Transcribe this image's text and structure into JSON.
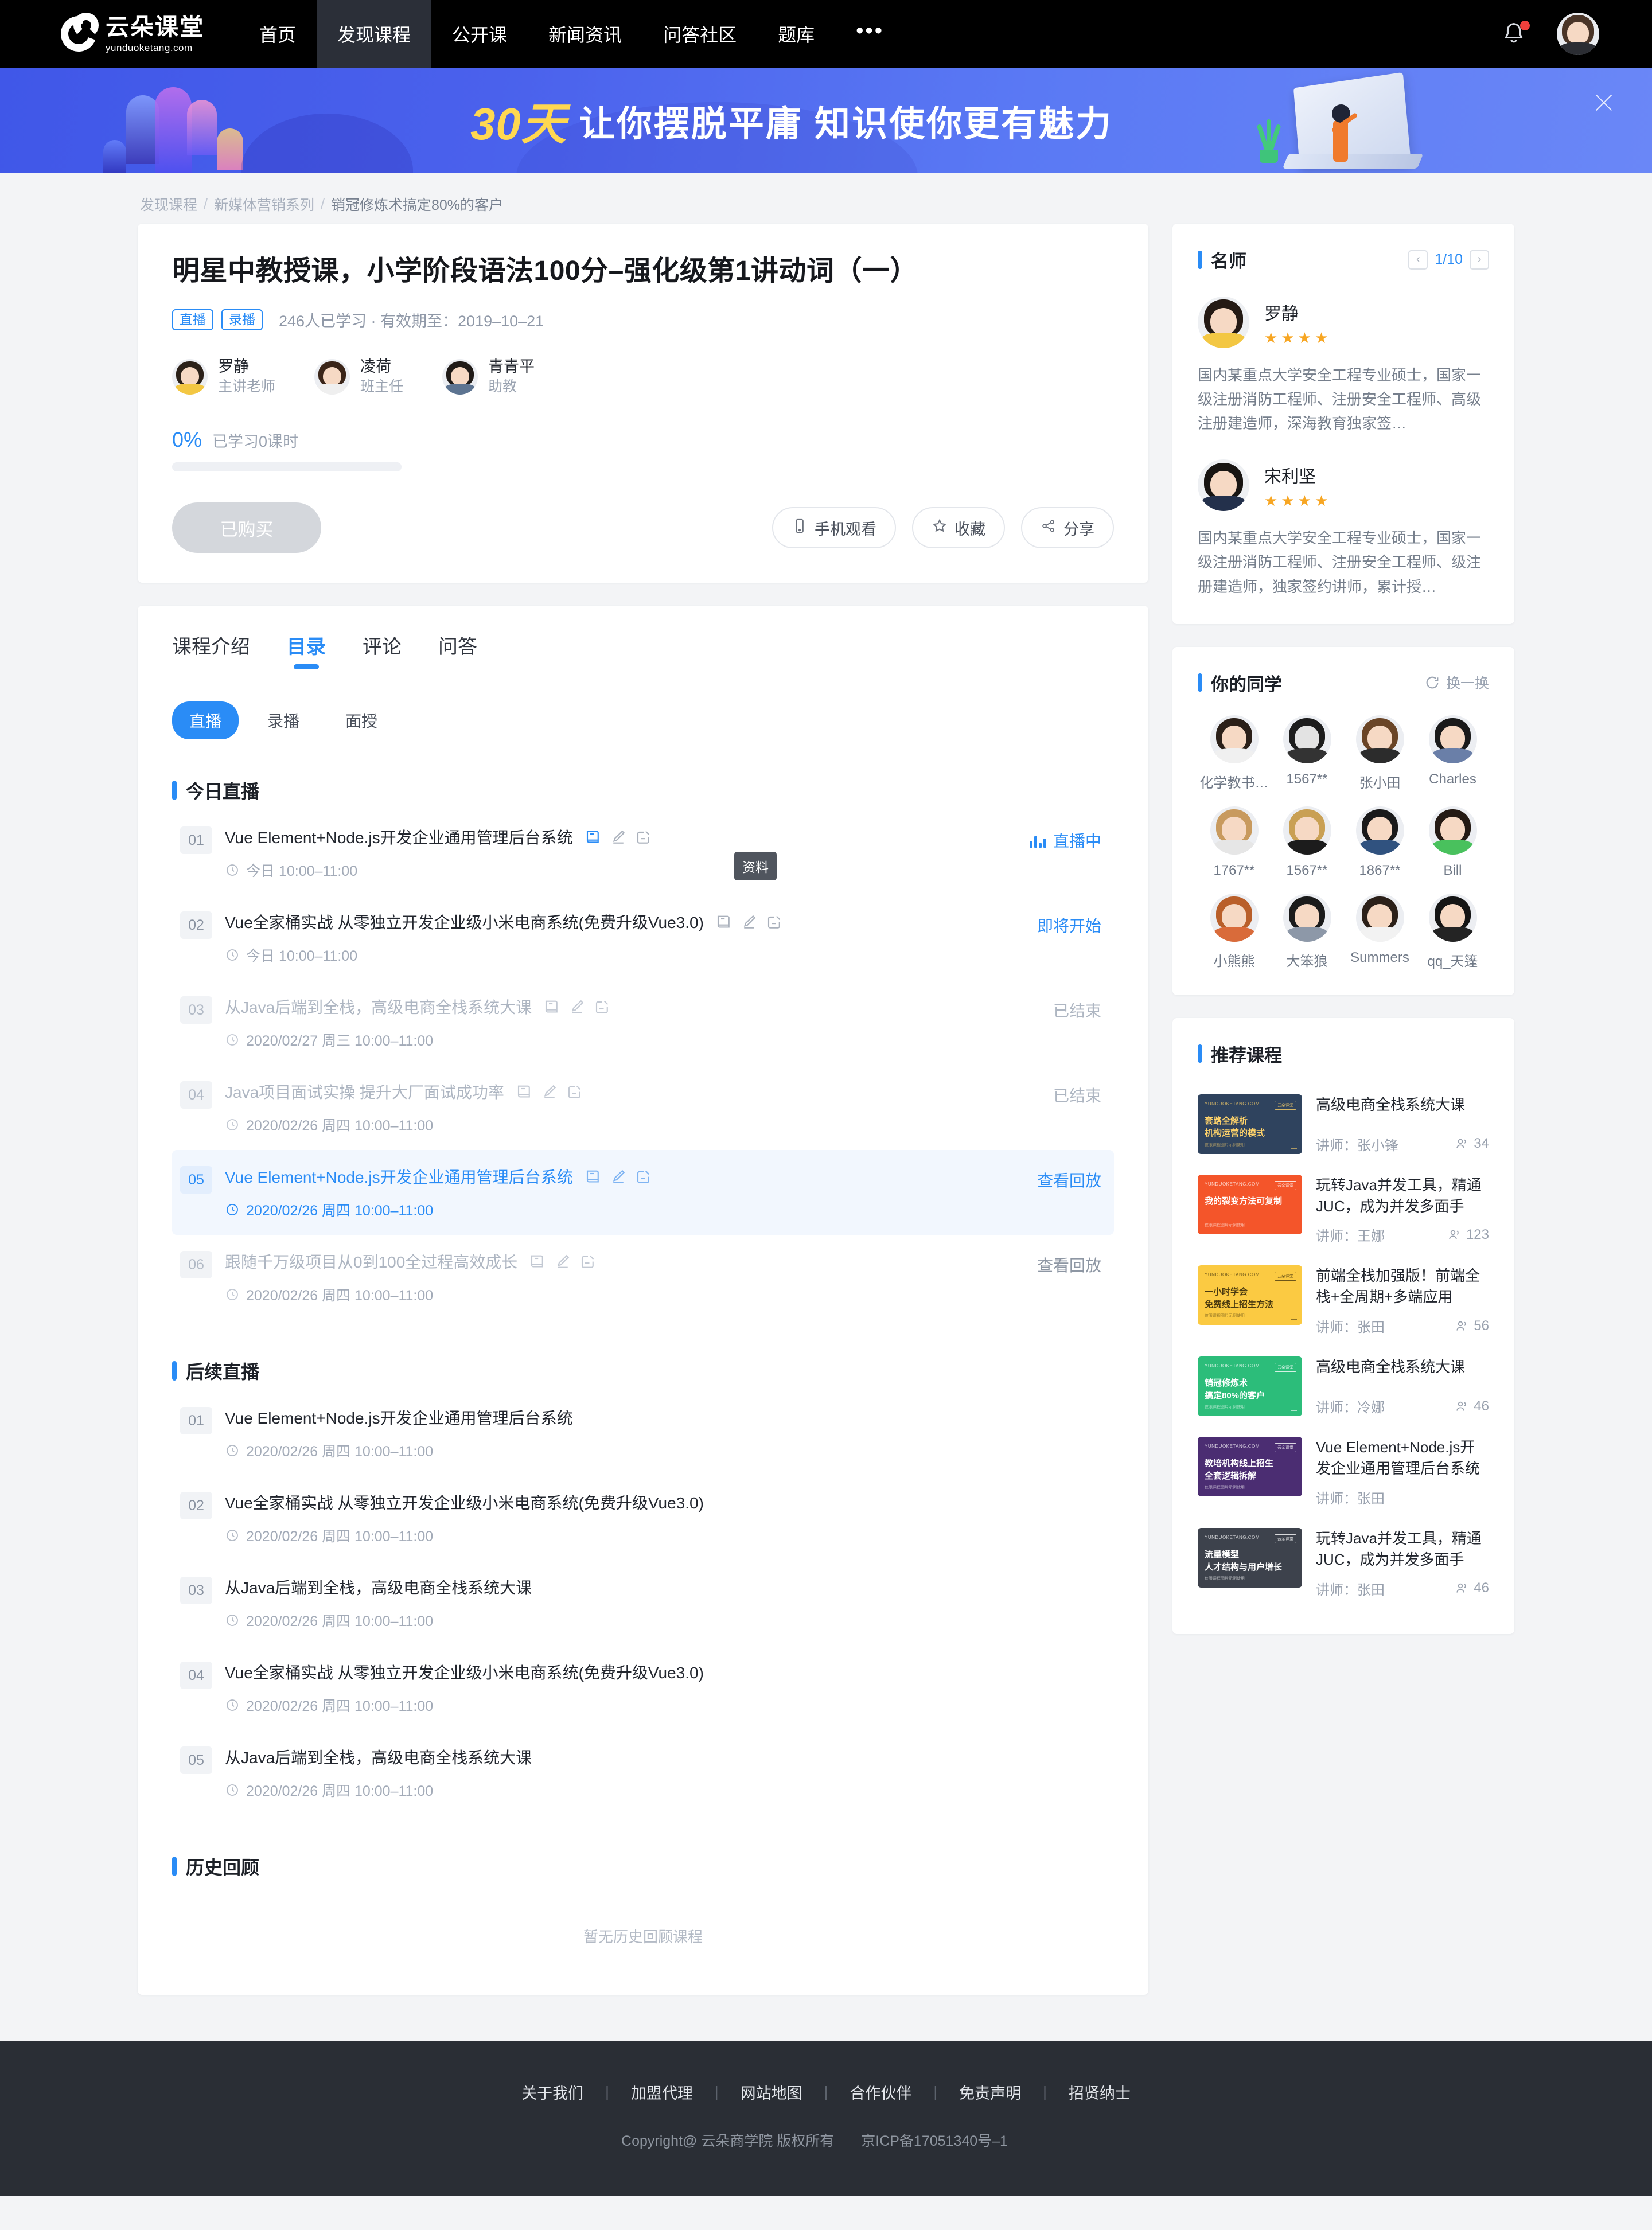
{
  "nav": {
    "logo_cn": "云朵课堂",
    "logo_en": "yunduoketang.com",
    "items": [
      {
        "label": "首页",
        "active": false
      },
      {
        "label": "发现课程",
        "active": true
      },
      {
        "label": "公开课",
        "active": false
      },
      {
        "label": "新闻资讯",
        "active": false
      },
      {
        "label": "问答社区",
        "active": false
      },
      {
        "label": "题库",
        "active": false
      }
    ],
    "more": "•••",
    "bell_icon": "bell-icon",
    "avatar_icon": "user-avatar"
  },
  "banner": {
    "highlight": "30天",
    "text": "让你摆脱平庸  知识使你更有魅力",
    "close_label": "×"
  },
  "breadcrumb": {
    "items": [
      "发现课程",
      "新媒体营销系列",
      "销冠修炼术搞定80%的客户"
    ],
    "sep": "/"
  },
  "course": {
    "title": "明星中教授课，小学阶段语法100分–强化级第1讲动词（一）",
    "tags": [
      "直播",
      "录播"
    ],
    "meta": "246人已学习 · 有效期至：2019–10–21",
    "teachers": [
      {
        "name": "罗静",
        "role": "主讲老师"
      },
      {
        "name": "凌荷",
        "role": "班主任"
      },
      {
        "name": "青青平",
        "role": "助教"
      }
    ],
    "progress_pct": "0%",
    "progress_label": "已学习0课时",
    "progress_value": 0,
    "buy_button": "已购买",
    "actions": [
      {
        "label": "手机观看",
        "icon": "phone-icon"
      },
      {
        "label": "收藏",
        "icon": "star-icon"
      },
      {
        "label": "分享",
        "icon": "share-icon"
      }
    ]
  },
  "tabs": [
    {
      "label": "课程介绍",
      "active": false
    },
    {
      "label": "目录",
      "active": true
    },
    {
      "label": "评论",
      "active": false
    },
    {
      "label": "问答",
      "active": false
    }
  ],
  "subtabs": [
    {
      "label": "直播",
      "active": true
    },
    {
      "label": "录播",
      "active": false
    },
    {
      "label": "面授",
      "active": false
    }
  ],
  "tooltip": "资料",
  "sections": [
    {
      "title": "今日直播",
      "lessons": [
        {
          "num": "01",
          "name": "Vue Element+Node.js开发企业通用管理后台系统",
          "time": "今日 10:00–11:00",
          "status": "直播中",
          "status_type": "live",
          "icons": true,
          "state": "normal"
        },
        {
          "num": "02",
          "name": "Vue全家桶实战 从零独立开发企业级小米电商系统(免费升级Vue3.0)",
          "time": "今日 10:00–11:00",
          "status": "即将开始",
          "status_type": "soon",
          "icons": true,
          "state": "normal"
        },
        {
          "num": "03",
          "name": "从Java后端到全栈，高级电商全栈系统大课",
          "time": "2020/02/27 周三 10:00–11:00",
          "status": "已结束",
          "status_type": "end",
          "icons": true,
          "state": "dim"
        },
        {
          "num": "04",
          "name": "Java项目面试实操 提升大厂面试成功率",
          "time": "2020/02/26 周四 10:00–11:00",
          "status": "已结束",
          "status_type": "end",
          "icons": true,
          "state": "dim"
        },
        {
          "num": "05",
          "name": "Vue Element+Node.js开发企业通用管理后台系统",
          "time": "2020/02/26 周四 10:00–11:00",
          "status": "查看回放",
          "status_type": "replay",
          "icons": true,
          "state": "hl"
        },
        {
          "num": "06",
          "name": "跟随千万级项目从0到100全过程高效成长",
          "time": "2020/02/26 周四 10:00–11:00",
          "status": "查看回放",
          "status_type": "replay",
          "icons": true,
          "state": "dim"
        }
      ]
    },
    {
      "title": "后续直播",
      "lessons": [
        {
          "num": "01",
          "name": "Vue Element+Node.js开发企业通用管理后台系统",
          "time": "2020/02/26 周四 10:00–11:00",
          "status": "",
          "status_type": "none",
          "icons": false,
          "state": "normal"
        },
        {
          "num": "02",
          "name": "Vue全家桶实战 从零独立开发企业级小米电商系统(免费升级Vue3.0)",
          "time": "2020/02/26 周四 10:00–11:00",
          "status": "",
          "status_type": "none",
          "icons": false,
          "state": "normal"
        },
        {
          "num": "03",
          "name": "从Java后端到全栈，高级电商全栈系统大课",
          "time": "2020/02/26 周四 10:00–11:00",
          "status": "",
          "status_type": "none",
          "icons": false,
          "state": "normal"
        },
        {
          "num": "04",
          "name": "Vue全家桶实战 从零独立开发企业级小米电商系统(免费升级Vue3.0)",
          "time": "2020/02/26 周四 10:00–11:00",
          "status": "",
          "status_type": "none",
          "icons": false,
          "state": "normal"
        },
        {
          "num": "05",
          "name": "从Java后端到全栈，高级电商全栈系统大课",
          "time": "2020/02/26 周四 10:00–11:00",
          "status": "",
          "status_type": "none",
          "icons": false,
          "state": "normal"
        }
      ]
    },
    {
      "title": "历史回顾",
      "lessons": [],
      "empty": "暂无历史回顾课程"
    }
  ],
  "sidebar": {
    "teacher_panel": {
      "title": "名师",
      "page": "1/10",
      "prev": "‹",
      "next": "›",
      "teachers": [
        {
          "name": "罗静",
          "stars": 4,
          "desc": "国内某重点大学安全工程专业硕士，国家一级注册消防工程师、注册安全工程师、高级注册建造师，深海教育独家签…"
        },
        {
          "name": "宋利坚",
          "stars": 4,
          "desc": "国内某重点大学安全工程专业硕士，国家一级注册消防工程师、注册安全工程师、级注册建造师，独家签约讲师，累计授…"
        }
      ]
    },
    "mates_panel": {
      "title": "你的同学",
      "refresh_label": "换一换",
      "refresh_icon": "refresh-icon",
      "mates": [
        {
          "name": "化学教书…"
        },
        {
          "name": "1567**"
        },
        {
          "name": "张小田"
        },
        {
          "name": "Charles"
        },
        {
          "name": "1767**"
        },
        {
          "name": "1567**"
        },
        {
          "name": "1867**"
        },
        {
          "name": "Bill"
        },
        {
          "name": "小熊熊"
        },
        {
          "name": "大笨狼"
        },
        {
          "name": "Summers"
        },
        {
          "name": "qq_天篷"
        }
      ]
    },
    "recommend_panel": {
      "title": "推荐课程",
      "teacher_prefix": "讲师：",
      "courses": [
        {
          "title": "高级电商全栈系统大课",
          "teacher": "讲师：张小锋",
          "count": "34",
          "thumb_title": "套路全解析\n机构运营的模式",
          "thumb_color": "#2f435e",
          "thumb_text_color": "#ffd36a",
          "brand": "YUNDUOKETANG.COM",
          "badge": "云朵课堂",
          "foot": "仅限课程图片示例使用"
        },
        {
          "title": "玩转Java并发工具，精通JUC，成为并发多面手",
          "teacher": "讲师：王娜",
          "count": "123",
          "thumb_title": "我的裂变方法可复制",
          "thumb_color": "#f4552a",
          "thumb_text_color": "#ffffff",
          "brand": "YUNDUOKETANG.COM",
          "badge": "云朵课堂",
          "foot": "仅限课程图片示例使用"
        },
        {
          "title": "前端全栈加强版！前端全栈+全周期+多端应用",
          "teacher": "讲师：张田",
          "count": "56",
          "thumb_title": "一小时学会\n免费线上招生方法",
          "thumb_color": "#fbca42",
          "thumb_text_color": "#4a3a10",
          "brand": "YUNDUOKETANG.COM",
          "badge": "云朵课堂",
          "foot": "仅限课程图片示例使用"
        },
        {
          "title": "高级电商全栈系统大课",
          "teacher": "讲师：冷娜",
          "count": "46",
          "thumb_title": "销冠修炼术\n搞定80%的客户",
          "thumb_color": "#2cbd7a",
          "thumb_text_color": "#ffffff",
          "brand": "YUNDUOKETANG.COM",
          "badge": "云朵课堂",
          "foot": "仅限课程图片示例使用"
        },
        {
          "title": "Vue Element+Node.js开发企业通用管理后台系统",
          "teacher": "讲师：张田",
          "count": "",
          "thumb_title": "教培机构线上招生\n全套逻辑拆解",
          "thumb_color": "#4b2d72",
          "thumb_text_color": "#ffffff",
          "brand": "YUNDUOKETANG.COM",
          "badge": "云朵课堂",
          "foot": "仅限课程图片示例使用"
        },
        {
          "title": "玩转Java并发工具，精通JUC，成为并发多面手",
          "teacher": "讲师：张田",
          "count": "46",
          "thumb_title": "流量模型\n人才结构与用户增长",
          "thumb_color": "#3d424c",
          "thumb_text_color": "#ffffff",
          "brand": "YUNDUOKETANG.COM",
          "badge": "云朵课堂",
          "foot": "仅限课程图片示例使用"
        }
      ]
    }
  },
  "footer": {
    "links": [
      "关于我们",
      "加盟代理",
      "网站地图",
      "合作伙伴",
      "免责声明",
      "招贤纳士"
    ],
    "divider": "|",
    "copyright": "Copyright@ 云朵商学院   版权所有",
    "icp": "京ICP备17051340号–1"
  },
  "colors": {
    "accent": "#2a8cf6",
    "nav_bg": "#000000",
    "footer_bg": "#2a2e35",
    "star": "#f7a623"
  }
}
